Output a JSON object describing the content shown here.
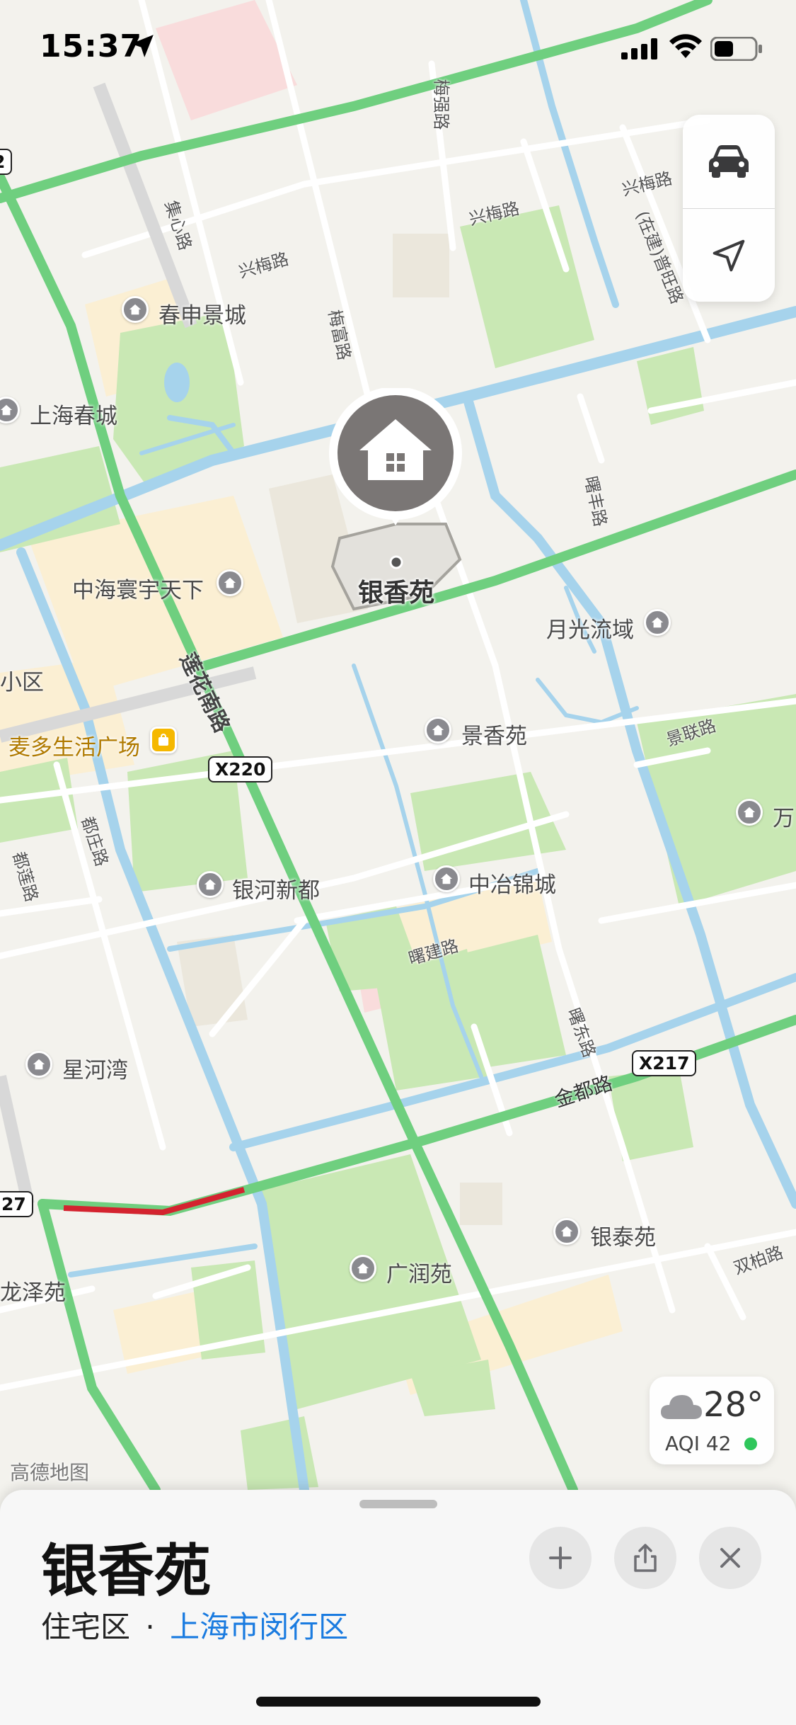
{
  "status_bar": {
    "time": "15:37"
  },
  "map_controls": {
    "driving_icon": "car-icon",
    "location_icon": "location-arrow-icon"
  },
  "weather": {
    "temperature": "28°",
    "aqi": "AQI 42",
    "aqi_color": "#2fc65b",
    "icon": "cloud-icon"
  },
  "map": {
    "watermark": "高德地图",
    "selected_place": {
      "name": "银香苑",
      "icon": "home-icon"
    },
    "pois": [
      {
        "name": "春申景城"
      },
      {
        "name": "上海春城"
      },
      {
        "name": "中海寰宇天下"
      },
      {
        "name": "月光流域"
      },
      {
        "name": "小区"
      },
      {
        "name": "麦多生活广场"
      },
      {
        "name": "景香苑"
      },
      {
        "name": "万"
      },
      {
        "name": "银河新都"
      },
      {
        "name": "中冶锦城"
      },
      {
        "name": "星河湾"
      },
      {
        "name": "银泰苑"
      },
      {
        "name": "广润苑"
      },
      {
        "name": "龙泽苑"
      }
    ],
    "roads": [
      {
        "name": "梅强路"
      },
      {
        "name": "兴梅路"
      },
      {
        "name": "兴梅路"
      },
      {
        "name": "兴梅路"
      },
      {
        "name": "集心路"
      },
      {
        "name": "梅富路"
      },
      {
        "name": "(在建)普旺路"
      },
      {
        "name": "曙丰路"
      },
      {
        "name": "莲花南路"
      },
      {
        "name": "景联路"
      },
      {
        "name": "都庄路"
      },
      {
        "name": "都莲路"
      },
      {
        "name": "曙建路"
      },
      {
        "name": "曙东路"
      },
      {
        "name": "金都路"
      },
      {
        "name": "双柏路"
      }
    ],
    "shields": [
      "X220",
      "X217",
      "27",
      "2"
    ]
  },
  "place_card": {
    "title": "银香苑",
    "category": "住宅区",
    "separator": "·",
    "district": "上海市闵行区",
    "add_icon": "plus-icon",
    "share_icon": "share-icon",
    "close_icon": "close-icon"
  }
}
